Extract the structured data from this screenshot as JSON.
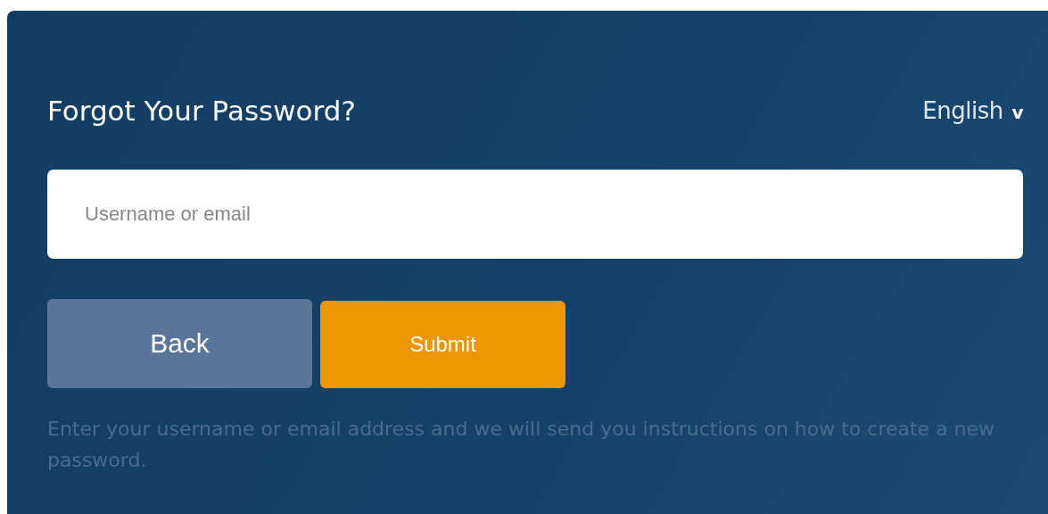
{
  "title": "Forgot Your Password?",
  "language": {
    "label": "English",
    "caret": "v"
  },
  "username_field": {
    "placeholder": "Username or email"
  },
  "buttons": [
    {
      "label": "Back",
      "kind": "secondary"
    },
    {
      "label": "Submit",
      "kind": "primary"
    }
  ],
  "help_text": "Enter your username or email address and we will send you instructions on how to create a new password."
}
